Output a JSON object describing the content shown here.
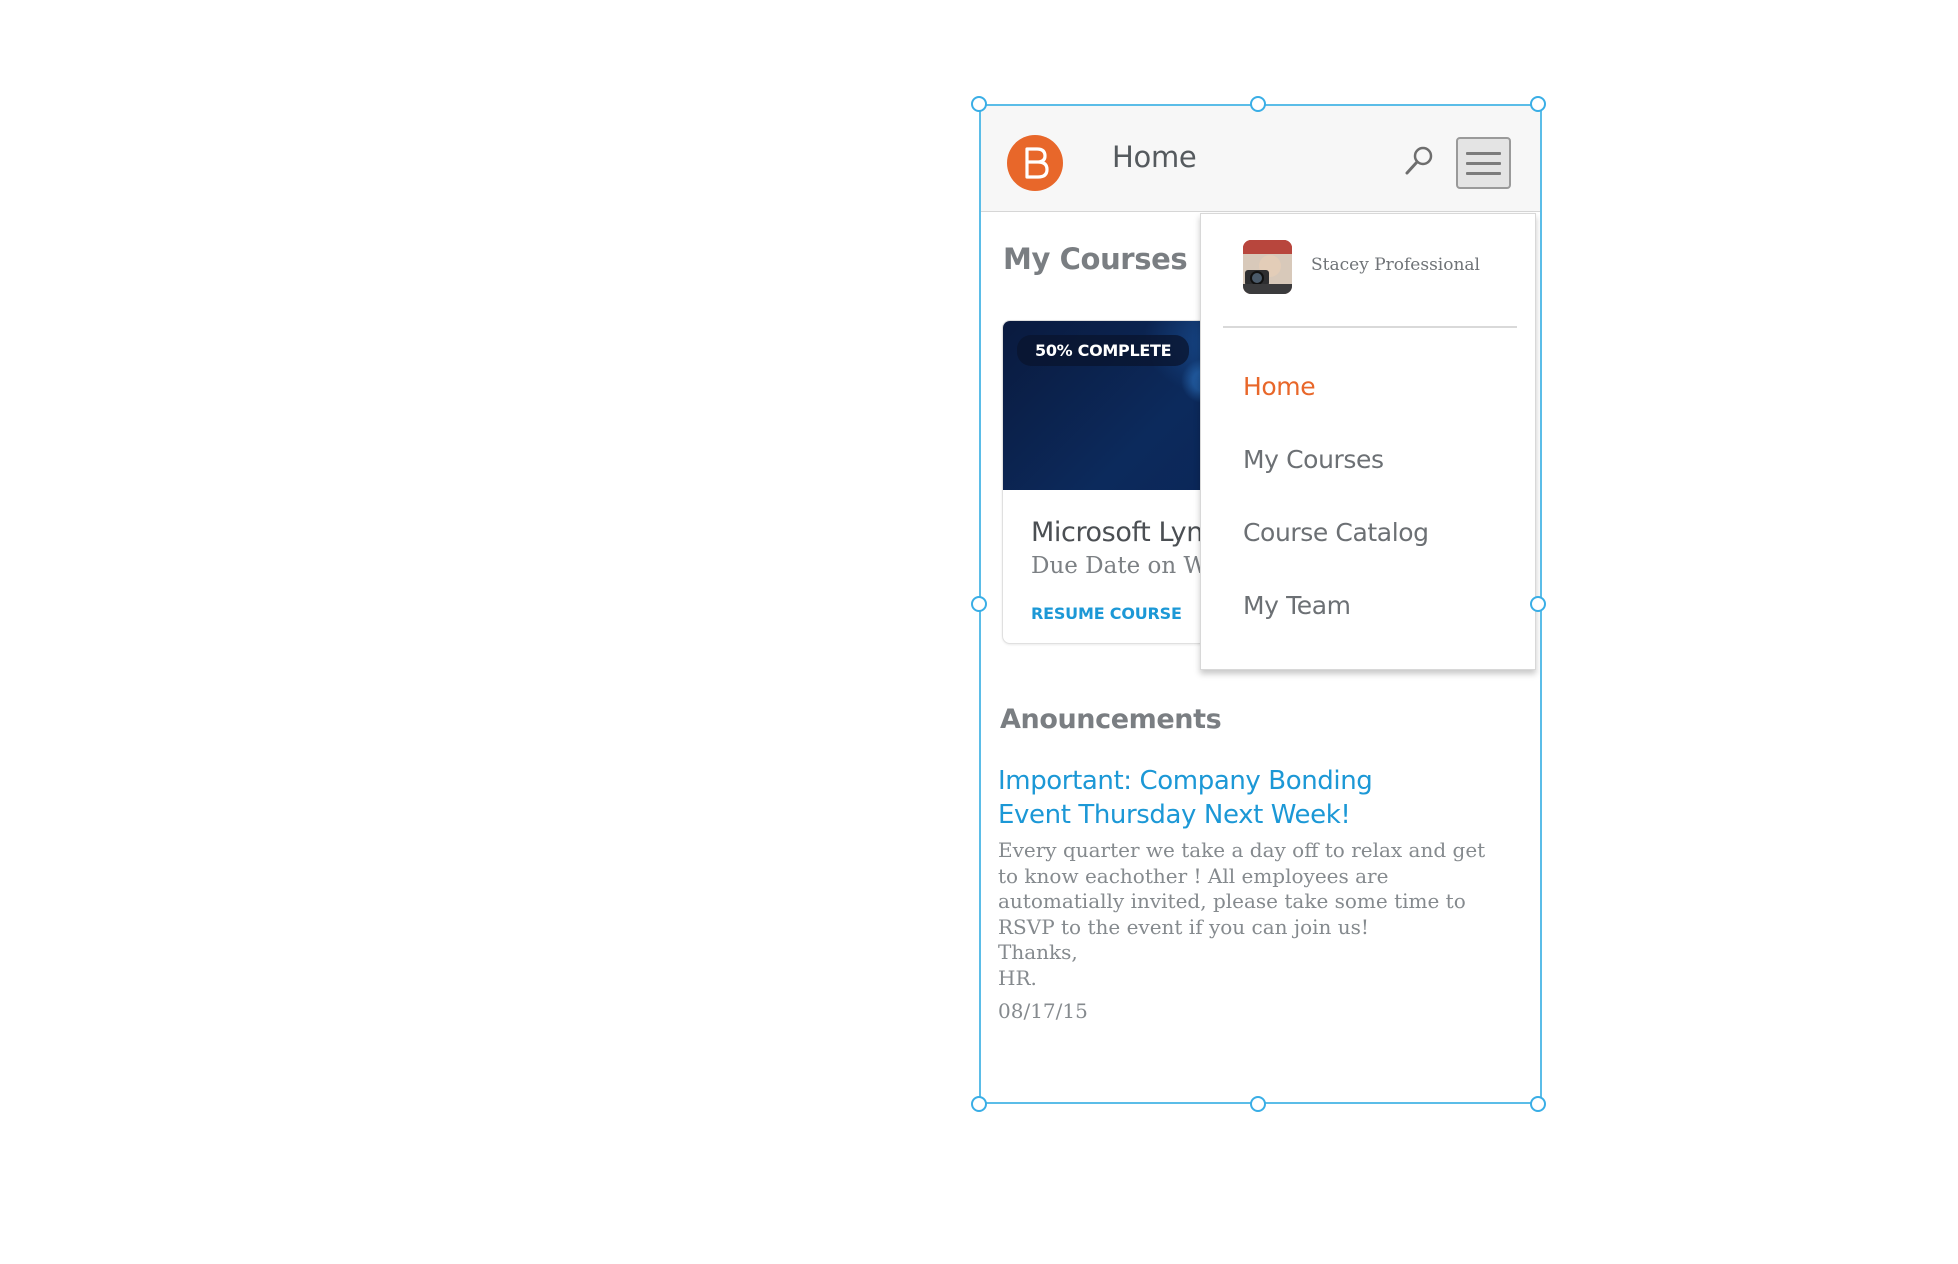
{
  "header": {
    "title": "Home",
    "logo_icon": "brightspace-logo-icon",
    "search_icon": "search-icon",
    "menu_icon": "hamburger-menu-icon",
    "brand_color": "#e8672a"
  },
  "my_courses": {
    "title": "My Courses",
    "course": {
      "progress": "50% COMPLETE",
      "progress_value": 0.5,
      "title": "Microsoft Lyn",
      "due": "Due Date on W",
      "action": "RESUME COURSE"
    }
  },
  "announcements": {
    "title": "Anouncements",
    "item": {
      "heading": "Important: Company Bonding Event Thursday Next Week!",
      "body": "Every quarter we take a day off to relax and get to know eachother ! All employees are automatially invited, please take some time to RSVP to the event if you can join us!\nThanks,\nHR.",
      "date": "08/17/15"
    }
  },
  "dropdown": {
    "user_name": "Stacey Professional",
    "items": [
      {
        "label": "Home",
        "active": true
      },
      {
        "label": "My Courses",
        "active": false
      },
      {
        "label": "Course Catalog",
        "active": false
      },
      {
        "label": "My Team",
        "active": false
      }
    ]
  },
  "colors": {
    "accent": "#e8672a",
    "link": "#1c98d6",
    "selection": "#3aaee6"
  }
}
